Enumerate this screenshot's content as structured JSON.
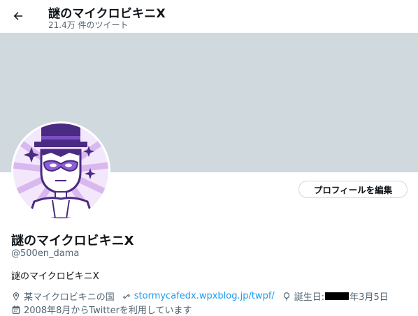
{
  "header": {
    "title": "謎のマイクロビキニX",
    "tweet_count": "21.4万 件のツイート"
  },
  "profile": {
    "edit_button": "プロフィールを編集",
    "display_name": "謎のマイクロビキニX",
    "handle": "@500en_dama",
    "bio": "謎のマイクロビキニX",
    "location": "某マイクロビキニの国",
    "website": "stormycafedx.wpxblog.jp/twpf/",
    "birthday_prefix": "誕生日:",
    "birthday_suffix": "年3月5日",
    "joined": "2008年8月からTwitterを利用しています"
  },
  "colors": {
    "banner": "#cfd9de",
    "link": "#1d9bf0",
    "secondary_text": "#536471",
    "avatar_purple": "#4a2a82"
  },
  "icons": [
    "back-arrow-icon",
    "location-icon",
    "link-icon",
    "balloon-icon",
    "calendar-icon"
  ]
}
